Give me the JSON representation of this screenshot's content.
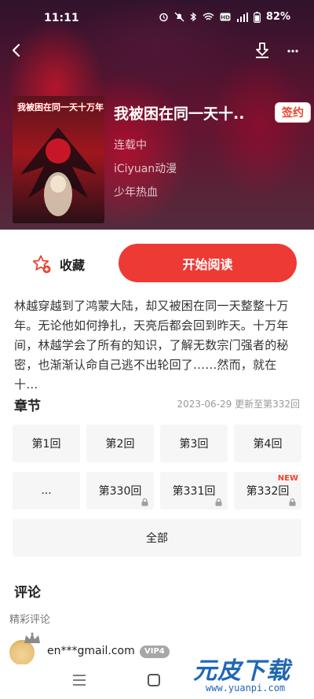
{
  "status_bar": {
    "time": "11:11",
    "battery_pct": "82%",
    "indicator_icons": [
      "alarm-icon",
      "mute-icon",
      "bluetooth-icon",
      "wifi-icon",
      "hd-icon",
      "signal-icon",
      "battery-icon"
    ]
  },
  "top_nav": {
    "back_icon": "chevron-left-icon",
    "download_icon": "download-icon",
    "more_icon": "more-dots-icon"
  },
  "book": {
    "cover_title": "我被困在同一天十万年",
    "title": "我被困在同一天十..",
    "status": "连载中",
    "publisher": "iCiyuan动漫",
    "genre": "少年热血",
    "badge": "签约"
  },
  "actions": {
    "collect_label": "收藏",
    "read_label": "开始阅读"
  },
  "description": "林越穿越到了鸿蒙大陆，却又被困在同一天整整十万年。无论他如何挣扎，天亮后都会回到昨天。十万年间，林越学会了所有的知识，了解无数宗门强者的秘密，也渐渐认命自己逃不出轮回了……然而，就在十…",
  "chapters": {
    "title": "章节",
    "update_info": "2023-06-29 更新至第332回",
    "items": [
      {
        "label": "第1回",
        "locked": false,
        "new": false
      },
      {
        "label": "第2回",
        "locked": false,
        "new": false
      },
      {
        "label": "第3回",
        "locked": false,
        "new": false
      },
      {
        "label": "第4回",
        "locked": false,
        "new": false
      },
      {
        "label": "...",
        "locked": false,
        "new": false
      },
      {
        "label": "第330回",
        "locked": true,
        "new": false
      },
      {
        "label": "第331回",
        "locked": true,
        "new": false
      },
      {
        "label": "第332回",
        "locked": true,
        "new": true
      }
    ],
    "new_tag": "NEW",
    "all_label": "全部"
  },
  "comments": {
    "title": "评论",
    "subtitle": "精彩评论",
    "first": {
      "username": "en***gmail.com",
      "vip": "VIP4"
    }
  },
  "watermark": {
    "text": "元皮下载",
    "url": "www.yuanpi.com"
  },
  "colors": {
    "accent": "#ee3a35",
    "badge_text": "#e8452f",
    "chip_bg": "#f6f6f6"
  }
}
